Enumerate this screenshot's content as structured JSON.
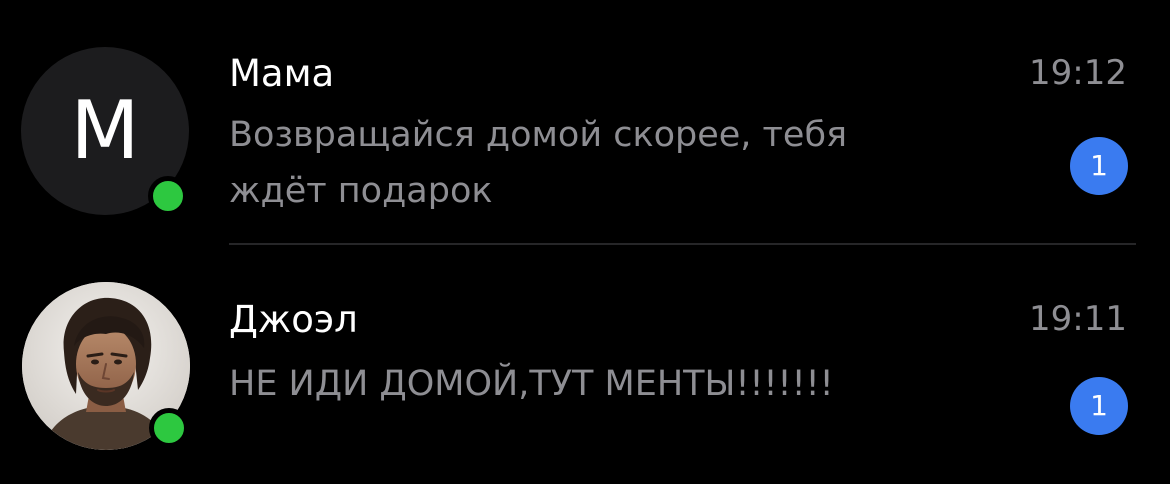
{
  "colors": {
    "background": "#000000",
    "text_primary": "#ffffff",
    "text_secondary": "#8e8e93",
    "online_indicator": "#2dc840",
    "unread_badge": "#3a7bf0",
    "divider": "#262628"
  },
  "chats": [
    {
      "name": "Мама",
      "avatar_initial": "М",
      "time": "19:12",
      "preview": "Возвращайся домой скорее, тебя ждёт подарок",
      "unread_count": "1",
      "online": true,
      "avatar_icon": "letter-avatar"
    },
    {
      "name": "Джоэл",
      "time": "19:11",
      "preview": "НЕ ИДИ ДОМОЙ,ТУТ МЕНТЫ!!!!!!!",
      "unread_count": "1",
      "online": true,
      "avatar_icon": "profile-photo-avatar"
    }
  ]
}
